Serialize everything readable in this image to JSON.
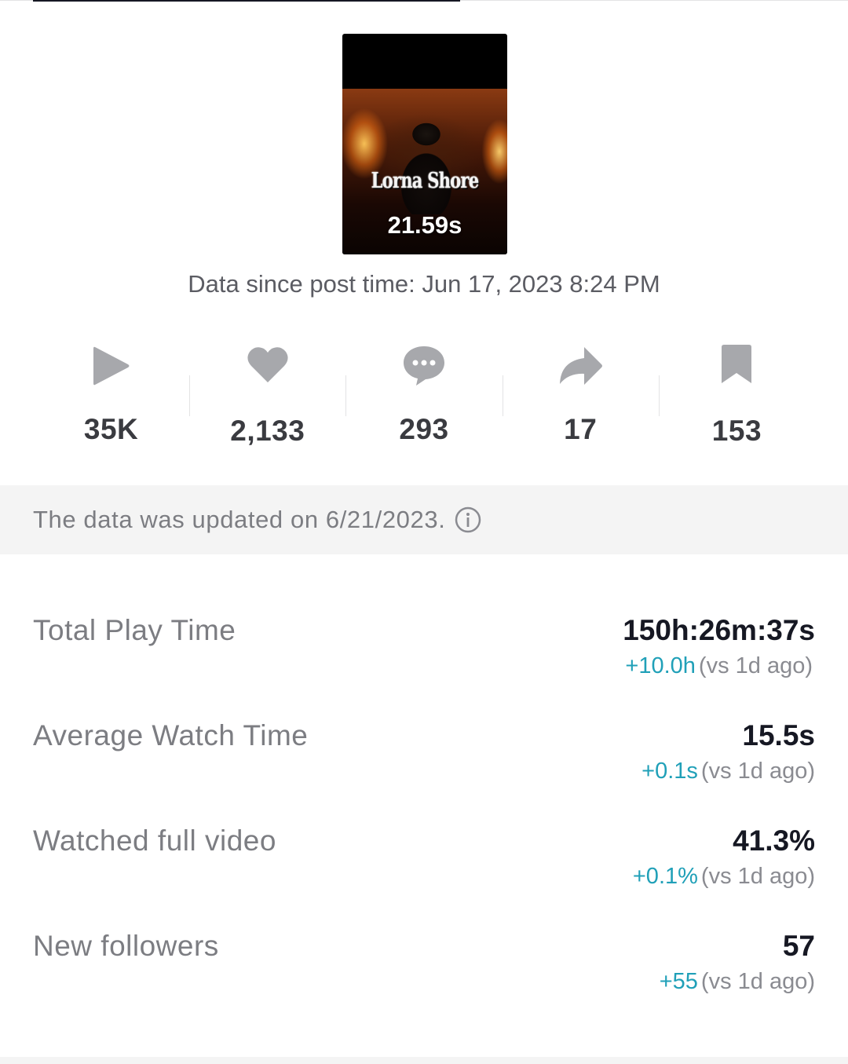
{
  "video": {
    "duration": "21.59s",
    "logo_text": "Lorna Shore",
    "post_time": "Data since post time: Jun 17, 2023 8:24 PM"
  },
  "stats": [
    {
      "icon": "play-icon",
      "value": "35K"
    },
    {
      "icon": "heart-icon",
      "value": "2,133"
    },
    {
      "icon": "comment-icon",
      "value": "293"
    },
    {
      "icon": "share-icon",
      "value": "17"
    },
    {
      "icon": "bookmark-icon",
      "value": "153"
    }
  ],
  "banner": {
    "text": "The data was updated on 6/21/2023.",
    "icon": "info-icon"
  },
  "metrics": [
    {
      "label": "Total Play Time",
      "value": "150h:26m:37s",
      "delta": "+10.0h",
      "compare": "(vs 1d ago)"
    },
    {
      "label": "Average Watch Time",
      "value": "15.5s",
      "delta": "+0.1s",
      "compare": "(vs 1d ago)"
    },
    {
      "label": "Watched full video",
      "value": "41.3%",
      "delta": "+0.1%",
      "compare": "(vs 1d ago)"
    },
    {
      "label": "New followers",
      "value": "57",
      "delta": "+55",
      "compare": "(vs 1d ago)"
    }
  ],
  "colors": {
    "icon_gray": "#a7a8ac",
    "delta_accent": "#20a0b8",
    "text_primary": "#161823",
    "text_secondary": "#7c7d82",
    "banner_bg": "#f4f4f4"
  }
}
